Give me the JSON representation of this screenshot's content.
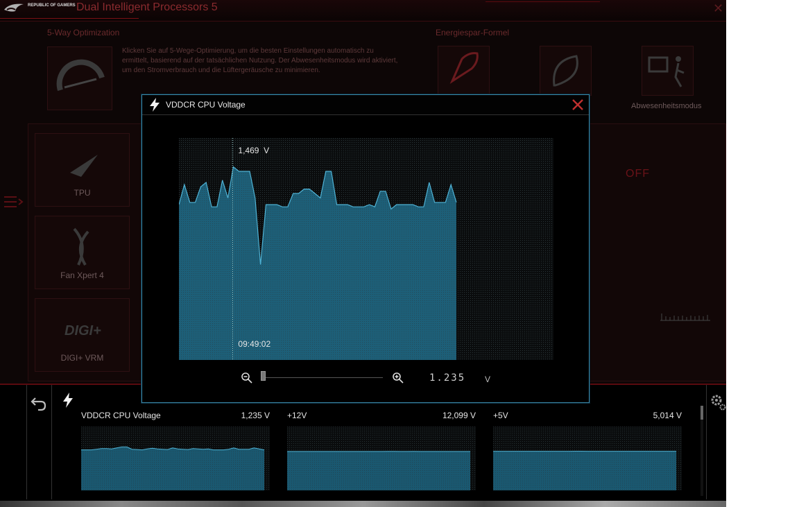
{
  "app": {
    "title": "Dual Intelligent Processors 5",
    "logo_text": "REPUBLIC OF GAMERS",
    "close_glyph": "✕"
  },
  "background": {
    "optimization": {
      "title": "5-Way Optimization",
      "description": "Klicken Sie auf 5-Wege-Optimierung, um die besten Einstellungen automatisch zu ermittelt, basierend auf der tatsächlichen Nutzung. Der Abwesenheitsmodus wird aktiviert, um den Stromverbrauch und die Lüftergeräusche zu minimieren."
    },
    "energy": {
      "title": "Energiespar-Formel",
      "away_label": "Abwesenheitsmodus"
    },
    "side_items": [
      {
        "label": "TPU",
        "icon": "tpu-icon"
      },
      {
        "label": "Fan Xpert 4",
        "icon": "fan-icon"
      },
      {
        "label": "DIGI+ VRM",
        "icon": "digi-icon"
      }
    ],
    "off_label": "OFF",
    "menu_icon": "menu-icon"
  },
  "modal": {
    "title": "VDDCR CPU Voltage",
    "icon": "bolt-icon",
    "close_icon": "close-icon",
    "lcd_value": "1.235",
    "lcd_unit": "V",
    "zoom_level": 0
  },
  "chart_data": [
    {
      "type": "area",
      "title": "VDDCR CPU Voltage",
      "cursor_value_label": "1,469  V",
      "cursor_time_label": "09:49:02",
      "ylim": [
        0.6,
        1.6
      ],
      "values": [
        1.3,
        1.39,
        1.31,
        1.31,
        1.38,
        1.4,
        1.29,
        1.29,
        1.41,
        1.33,
        1.47,
        1.45,
        1.45,
        1.45,
        1.33,
        1.03,
        1.3,
        1.3,
        1.3,
        1.29,
        1.29,
        1.35,
        1.35,
        1.37,
        1.37,
        1.35,
        1.33,
        1.45,
        1.45,
        1.3,
        1.3,
        1.3,
        1.29,
        1.29,
        1.29,
        1.3,
        1.29,
        1.36,
        1.36,
        1.28,
        1.3,
        1.3,
        1.3,
        1.3,
        1.29,
        1.29,
        1.4,
        1.31,
        1.31,
        1.31,
        1.39,
        1.31
      ],
      "colors": {
        "fill": "#1d5f78",
        "line": "#4fb2d4",
        "grid": "#1e2a2e"
      }
    },
    {
      "type": "area",
      "title": "VDDCR CPU Voltage",
      "value_label": "1,235 V",
      "values": [
        1.235,
        1.235,
        1.235,
        1.245,
        1.255,
        1.255,
        1.25,
        1.265,
        1.28,
        1.28,
        1.245,
        1.24,
        1.235,
        1.25,
        1.26,
        1.25,
        1.245,
        1.24,
        1.265,
        1.25,
        1.245,
        1.24,
        1.255,
        1.25,
        1.245,
        1.25,
        1.235,
        1.235,
        1.235,
        1.245,
        1.265,
        1.245,
        1.245,
        1.245,
        1.265,
        1.25,
        1.235
      ],
      "ylim": [
        0.6,
        1.6
      ]
    },
    {
      "type": "area",
      "title": "+12V",
      "value_label": "12,099 V",
      "values": [
        12.099,
        12.099,
        12.099,
        12.099,
        12.099,
        12.099,
        12.099,
        12.099,
        12.099,
        12.099,
        12.099,
        12.099,
        12.099,
        12.099,
        12.099,
        12.099,
        12.12,
        12.12,
        12.099,
        12.099,
        12.11,
        12.099,
        12.099,
        12.099,
        12.099,
        12.099,
        12.099,
        12.099,
        12.099,
        12.099
      ],
      "ylim": [
        6.0,
        16.0
      ]
    },
    {
      "type": "area",
      "title": "+5V",
      "value_label": "5,014 V",
      "values": [
        5.014,
        5.014,
        5.014,
        5.014,
        5.014,
        5.014,
        5.014,
        5.014,
        5.014,
        5.014,
        5.014,
        5.014,
        5.014,
        5.02,
        5.02,
        5.014,
        5.014,
        5.014,
        5.014,
        5.014,
        5.014,
        5.014,
        5.014,
        5.014,
        5.014,
        5.014,
        5.014,
        5.014,
        5.014,
        5.014
      ],
      "ylim": [
        2.5,
        6.6
      ]
    }
  ],
  "monitor": {
    "back_icon": "undo-icon",
    "bolt_icon": "bolt-icon",
    "gear_icon": "gear-icon",
    "items": [
      {
        "label": "VDDCR CPU Voltage",
        "value": "1,235 V"
      },
      {
        "label": "+12V",
        "value": "12,099 V"
      },
      {
        "label": "+5V",
        "value": "5,014 V"
      }
    ]
  }
}
